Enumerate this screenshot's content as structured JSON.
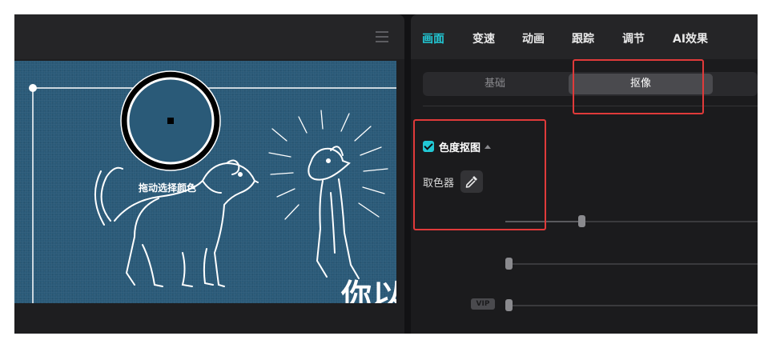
{
  "preview": {
    "drag_hint": "拖动选择颜色",
    "canvas_text": "你以"
  },
  "tabs": [
    {
      "label": "画面",
      "active": true
    },
    {
      "label": "变速",
      "active": false
    },
    {
      "label": "动画",
      "active": false
    },
    {
      "label": "跟踪",
      "active": false
    },
    {
      "label": "调节",
      "active": false
    },
    {
      "label": "AI效果",
      "active": false
    }
  ],
  "segment": {
    "basic_label": "基础",
    "cutout_label": "抠像",
    "selected": "抠像"
  },
  "chroma_key": {
    "label": "色度抠图",
    "checked": true,
    "picker_label": "取色器"
  },
  "vip_badge": "VIP",
  "colors": {
    "accent": "#22c8d5",
    "highlight": "#e03a3a",
    "canvas_bg": "#2a5a78"
  },
  "icons": [
    "menu-icon",
    "eyedropper-icon",
    "checkbox-checked-icon",
    "collapse-caret-icon"
  ]
}
